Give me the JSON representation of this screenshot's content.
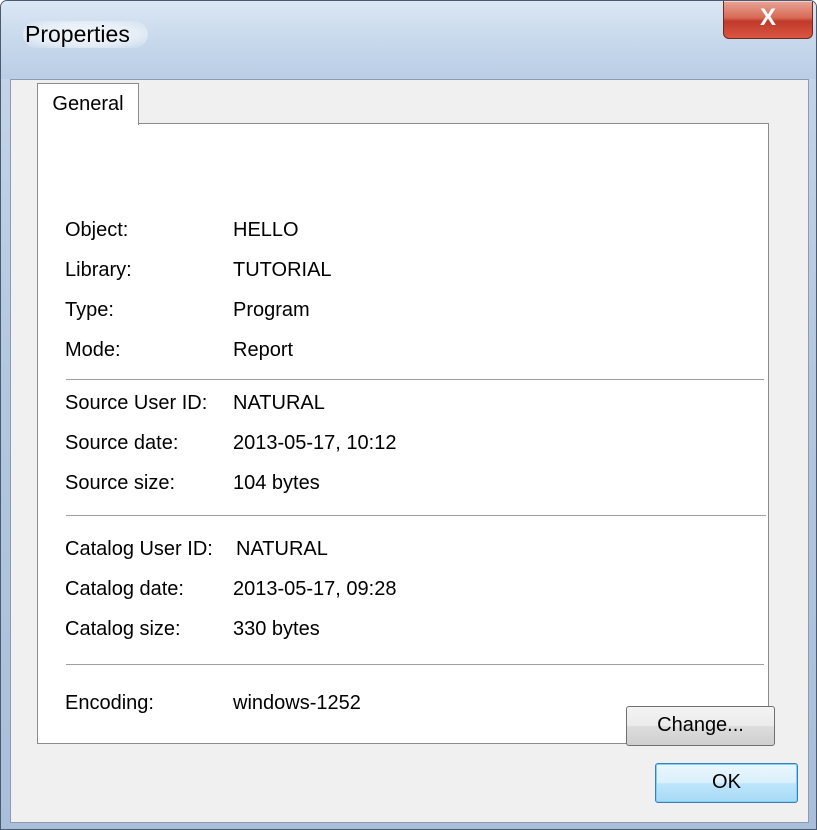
{
  "window": {
    "title": "Properties",
    "close_glyph": "X"
  },
  "tabs": [
    {
      "label": "General"
    }
  ],
  "object_info": {
    "object_label": "Object:",
    "object_value": "HELLO",
    "library_label": "Library:",
    "library_value": "TUTORIAL",
    "type_label": "Type:",
    "type_value": "Program",
    "mode_label": "Mode:",
    "mode_value": "Report"
  },
  "source_info": {
    "user_label": "Source User ID:",
    "user_value": "NATURAL",
    "date_label": "Source date:",
    "date_value": "2013-05-17,  10:12",
    "size_label": "Source size:",
    "size_value": "104 bytes"
  },
  "catalog_info": {
    "user_label": "Catalog User ID:",
    "user_value": "NATURAL",
    "date_label": "Catalog date:",
    "date_value": "2013-05-17,  09:28",
    "size_label": "Catalog size:",
    "size_value": "330 bytes"
  },
  "encoding": {
    "label": "Encoding:",
    "value": "windows-1252",
    "change_button": "Change..."
  },
  "footer": {
    "ok_button": "OK"
  },
  "colors": {
    "title_bar": "#c8d9ec",
    "close_button": "#c0392b",
    "panel_background": "#f0f0f0",
    "ok_button_border": "#3c7fb1"
  }
}
